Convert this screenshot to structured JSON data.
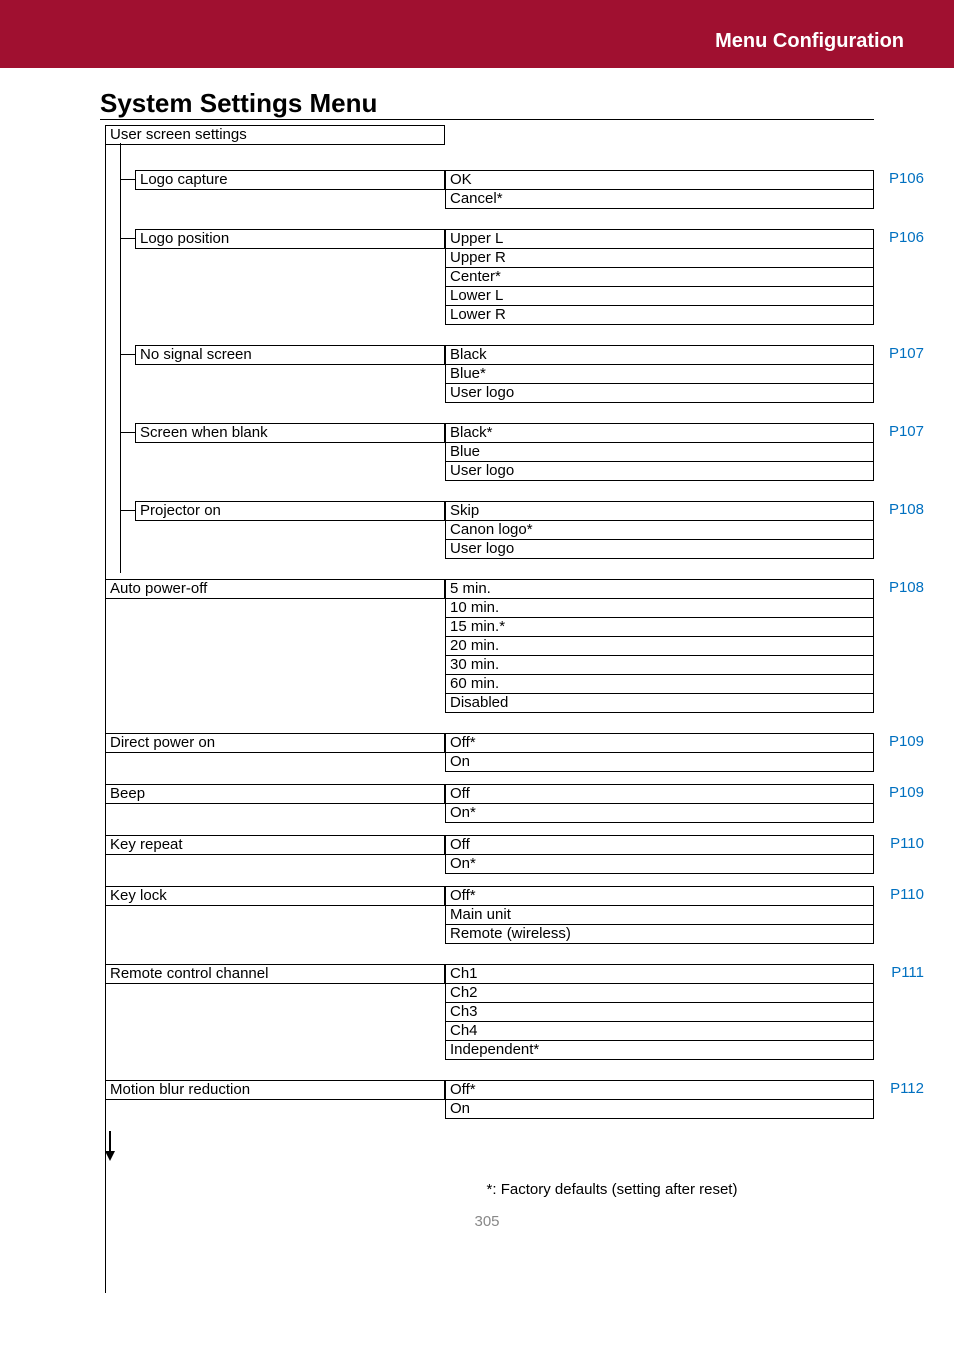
{
  "header": {
    "title": "Menu Configuration"
  },
  "page_title": "System Settings Menu",
  "page_number": "305",
  "footnote": "*: Factory defaults (setting after reset)",
  "tree": {
    "root_label": "User screen settings",
    "subsections": [
      {
        "label": "Logo capture",
        "page_ref": "P106",
        "options": [
          "OK",
          "Cancel*"
        ]
      },
      {
        "label": "Logo position",
        "page_ref": "P106",
        "options": [
          "Upper L",
          "Upper R",
          "Center*",
          "Lower L",
          "Lower R"
        ]
      },
      {
        "label": "No signal screen",
        "page_ref": "P107",
        "options": [
          "Black",
          "Blue*",
          "User logo"
        ]
      },
      {
        "label": "Screen when blank",
        "page_ref": "P107",
        "options": [
          "Black*",
          "Blue",
          "User logo"
        ]
      },
      {
        "label": "Projector on",
        "page_ref": "P108",
        "options": [
          "Skip",
          "Canon logo*",
          "User logo"
        ]
      }
    ],
    "sections": [
      {
        "label": "Auto power-off",
        "page_ref": "P108",
        "options": [
          "5 min.",
          "10 min.",
          "15 min.*",
          "20 min.",
          "30 min.",
          "60 min.",
          "Disabled"
        ]
      },
      {
        "label": "Direct power on",
        "page_ref": "P109",
        "options": [
          "Off*",
          "On"
        ]
      },
      {
        "label": "Beep",
        "page_ref": "P109",
        "options": [
          "Off",
          "On*"
        ]
      },
      {
        "label": "Key repeat",
        "page_ref": "P110",
        "options": [
          "Off",
          "On*"
        ]
      },
      {
        "label": "Key lock",
        "page_ref": "P110",
        "options": [
          "Off*",
          "Main unit",
          "Remote (wireless)"
        ]
      },
      {
        "label": "Remote control channel",
        "page_ref": "P111",
        "options": [
          "Ch1",
          "Ch2",
          "Ch3",
          "Ch4",
          "Independent*"
        ]
      },
      {
        "label": "Motion blur reduction",
        "page_ref": "P112",
        "options": [
          "Off*",
          "On"
        ]
      }
    ]
  }
}
